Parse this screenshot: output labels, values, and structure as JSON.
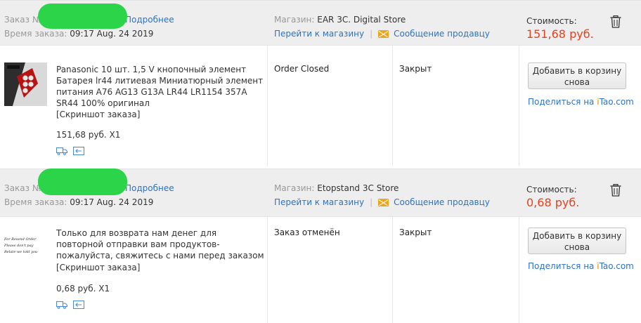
{
  "labels": {
    "order_no": "Заказ №",
    "details": "Подробнее",
    "order_time": "Время заказа:",
    "store": "Магазин:",
    "goto_store": "Перейти к магазину",
    "message_seller": "Сообщение продавцу",
    "cost": "Стоимость:",
    "snapshot": "[Скриншот заказа]",
    "add_to_cart": "Добавить в корзину снова",
    "share_prefix": "Поделиться на ",
    "share_brand_i": "i",
    "share_brand_rest": "Tao.com"
  },
  "orders": [
    {
      "time": "09:17 Aug. 24 2019",
      "store_name": "EAR 3C. Digital Store",
      "cost": "151,68 руб.",
      "product_title": "Panasonic 10 шт. 1,5 V кнопочный элемент Батарея lr44 литиевая Миниатюрный элемент питания A76 AG13 G13A LR44 LR1154 357A SR44 100% оригинал",
      "price_qty": "151,68 руб. X1",
      "order_status": "Order Closed",
      "trade_status": "Закрыт"
    },
    {
      "time": "09:17 Aug. 24 2019",
      "store_name": "Etopstand 3C Store",
      "cost": "0,68 руб.",
      "product_title": "Только для возврата нам денег для повторной отправки вам продуктов-пожалуйста, свяжитесь с нами перед заказом",
      "price_qty": "0,68 руб. X1",
      "order_status": "Заказ отменён",
      "trade_status": "Закрыт",
      "thumb_text": [
        "For Resend Order",
        "Please don't pay",
        "Relate we told you"
      ]
    }
  ],
  "colors": {
    "price": "#e8401c",
    "link": "#2a73c9",
    "header_bg": "#eeeeee",
    "redaction": "#2cd44a",
    "mail": "#f2a31b"
  }
}
